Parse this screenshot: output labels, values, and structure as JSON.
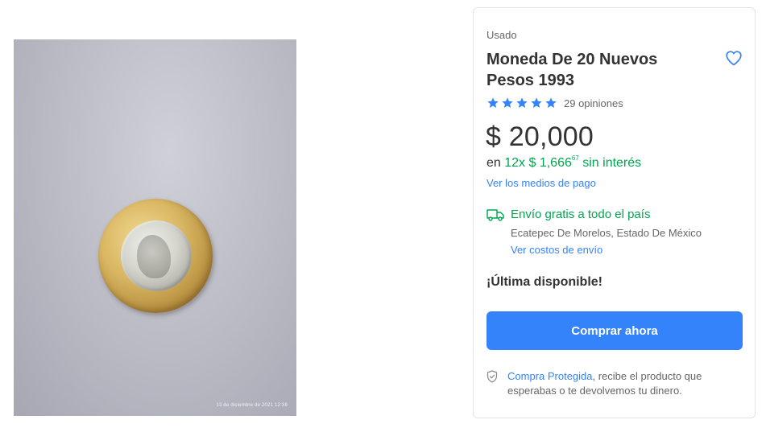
{
  "product_image": {
    "timestamp": "13 de diciembre de 2021 12:38"
  },
  "product": {
    "condition": "Usado",
    "title": "Moneda De 20 Nuevos Pesos 1993",
    "rating": 5,
    "reviews_label": "29 opiniones",
    "price": "$ 20,000",
    "installments": {
      "prefix": "en",
      "amount": "12x $ 1,666",
      "cents": "67",
      "suffix": "sin interés"
    },
    "payment_link": "Ver los medios de pago"
  },
  "shipping": {
    "title": "Envío gratis a todo el país",
    "location": "Ecatepec De Morelos, Estado De México",
    "costs_link": "Ver costos de envío"
  },
  "stock_label": "¡Última disponible!",
  "buy_button": "Comprar ahora",
  "protection": {
    "link": "Compra Protegida",
    "text": ", recibe el producto que esperabas o te devolvemos tu dinero."
  },
  "colors": {
    "accent": "#3483fa",
    "success": "#00a650",
    "text": "#333333",
    "muted": "#666666"
  },
  "icons": {
    "favorite": "heart-icon",
    "rating": "star-icon",
    "shipping": "truck-icon",
    "protection": "shield-icon"
  }
}
